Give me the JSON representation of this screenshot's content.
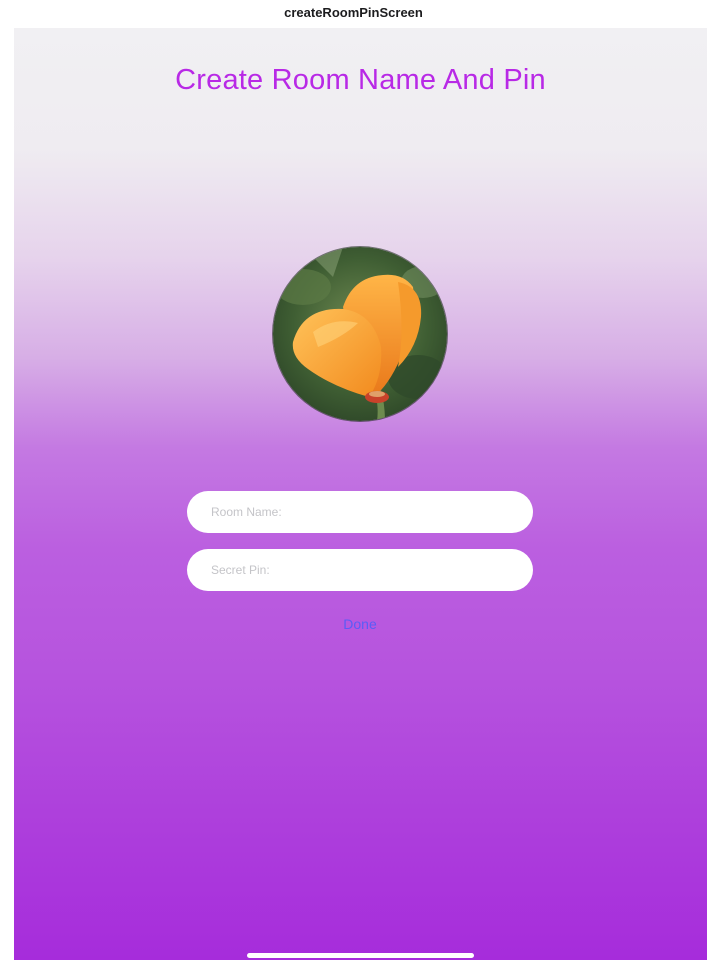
{
  "window": {
    "title": "createRoomPinScreen"
  },
  "screen": {
    "title": "Create Room Name And Pin",
    "title_color": "#b829e6",
    "gradient_top": "#f1f0f3",
    "gradient_bottom": "#a62cdb"
  },
  "form": {
    "room_name_placeholder": "Room Name:",
    "secret_pin_placeholder": "Secret Pin:",
    "done_label": "Done",
    "done_color": "#5b5cf6"
  },
  "avatar": {
    "icon": "poppy-flower-photo"
  }
}
